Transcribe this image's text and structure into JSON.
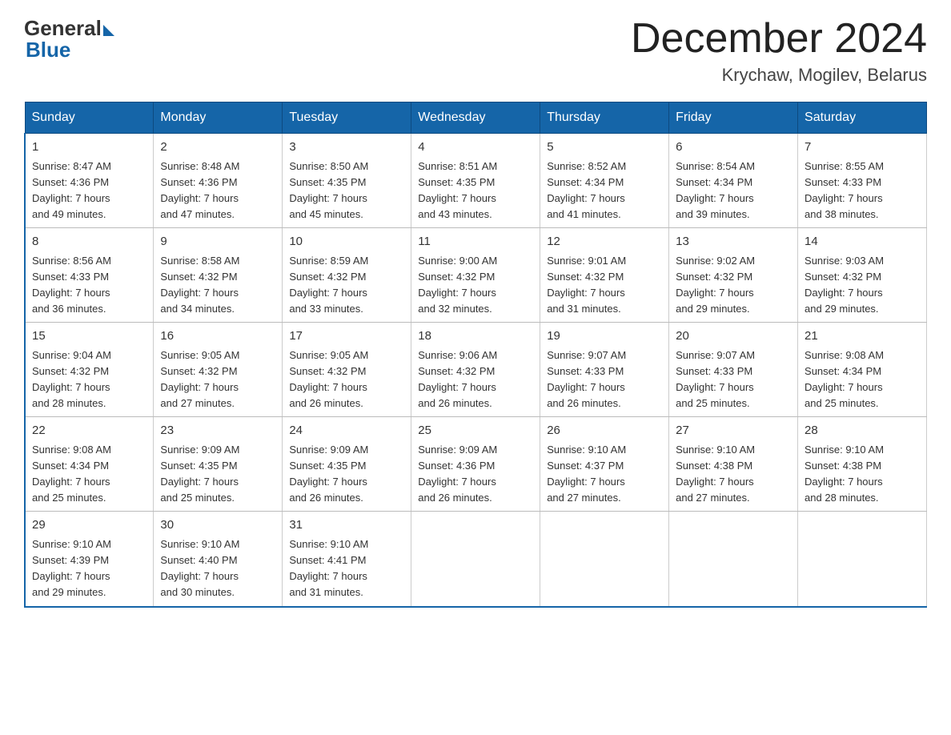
{
  "logo": {
    "text_general": "General",
    "text_blue": "Blue"
  },
  "header": {
    "month_title": "December 2024",
    "location": "Krychaw, Mogilev, Belarus"
  },
  "days_of_week": [
    "Sunday",
    "Monday",
    "Tuesday",
    "Wednesday",
    "Thursday",
    "Friday",
    "Saturday"
  ],
  "weeks": [
    [
      {
        "day": "1",
        "sunrise": "8:47 AM",
        "sunset": "4:36 PM",
        "daylight": "7 hours and 49 minutes."
      },
      {
        "day": "2",
        "sunrise": "8:48 AM",
        "sunset": "4:36 PM",
        "daylight": "7 hours and 47 minutes."
      },
      {
        "day": "3",
        "sunrise": "8:50 AM",
        "sunset": "4:35 PM",
        "daylight": "7 hours and 45 minutes."
      },
      {
        "day": "4",
        "sunrise": "8:51 AM",
        "sunset": "4:35 PM",
        "daylight": "7 hours and 43 minutes."
      },
      {
        "day": "5",
        "sunrise": "8:52 AM",
        "sunset": "4:34 PM",
        "daylight": "7 hours and 41 minutes."
      },
      {
        "day": "6",
        "sunrise": "8:54 AM",
        "sunset": "4:34 PM",
        "daylight": "7 hours and 39 minutes."
      },
      {
        "day": "7",
        "sunrise": "8:55 AM",
        "sunset": "4:33 PM",
        "daylight": "7 hours and 38 minutes."
      }
    ],
    [
      {
        "day": "8",
        "sunrise": "8:56 AM",
        "sunset": "4:33 PM",
        "daylight": "7 hours and 36 minutes."
      },
      {
        "day": "9",
        "sunrise": "8:58 AM",
        "sunset": "4:32 PM",
        "daylight": "7 hours and 34 minutes."
      },
      {
        "day": "10",
        "sunrise": "8:59 AM",
        "sunset": "4:32 PM",
        "daylight": "7 hours and 33 minutes."
      },
      {
        "day": "11",
        "sunrise": "9:00 AM",
        "sunset": "4:32 PM",
        "daylight": "7 hours and 32 minutes."
      },
      {
        "day": "12",
        "sunrise": "9:01 AM",
        "sunset": "4:32 PM",
        "daylight": "7 hours and 31 minutes."
      },
      {
        "day": "13",
        "sunrise": "9:02 AM",
        "sunset": "4:32 PM",
        "daylight": "7 hours and 29 minutes."
      },
      {
        "day": "14",
        "sunrise": "9:03 AM",
        "sunset": "4:32 PM",
        "daylight": "7 hours and 29 minutes."
      }
    ],
    [
      {
        "day": "15",
        "sunrise": "9:04 AM",
        "sunset": "4:32 PM",
        "daylight": "7 hours and 28 minutes."
      },
      {
        "day": "16",
        "sunrise": "9:05 AM",
        "sunset": "4:32 PM",
        "daylight": "7 hours and 27 minutes."
      },
      {
        "day": "17",
        "sunrise": "9:05 AM",
        "sunset": "4:32 PM",
        "daylight": "7 hours and 26 minutes."
      },
      {
        "day": "18",
        "sunrise": "9:06 AM",
        "sunset": "4:32 PM",
        "daylight": "7 hours and 26 minutes."
      },
      {
        "day": "19",
        "sunrise": "9:07 AM",
        "sunset": "4:33 PM",
        "daylight": "7 hours and 26 minutes."
      },
      {
        "day": "20",
        "sunrise": "9:07 AM",
        "sunset": "4:33 PM",
        "daylight": "7 hours and 25 minutes."
      },
      {
        "day": "21",
        "sunrise": "9:08 AM",
        "sunset": "4:34 PM",
        "daylight": "7 hours and 25 minutes."
      }
    ],
    [
      {
        "day": "22",
        "sunrise": "9:08 AM",
        "sunset": "4:34 PM",
        "daylight": "7 hours and 25 minutes."
      },
      {
        "day": "23",
        "sunrise": "9:09 AM",
        "sunset": "4:35 PM",
        "daylight": "7 hours and 25 minutes."
      },
      {
        "day": "24",
        "sunrise": "9:09 AM",
        "sunset": "4:35 PM",
        "daylight": "7 hours and 26 minutes."
      },
      {
        "day": "25",
        "sunrise": "9:09 AM",
        "sunset": "4:36 PM",
        "daylight": "7 hours and 26 minutes."
      },
      {
        "day": "26",
        "sunrise": "9:10 AM",
        "sunset": "4:37 PM",
        "daylight": "7 hours and 27 minutes."
      },
      {
        "day": "27",
        "sunrise": "9:10 AM",
        "sunset": "4:38 PM",
        "daylight": "7 hours and 27 minutes."
      },
      {
        "day": "28",
        "sunrise": "9:10 AM",
        "sunset": "4:38 PM",
        "daylight": "7 hours and 28 minutes."
      }
    ],
    [
      {
        "day": "29",
        "sunrise": "9:10 AM",
        "sunset": "4:39 PM",
        "daylight": "7 hours and 29 minutes."
      },
      {
        "day": "30",
        "sunrise": "9:10 AM",
        "sunset": "4:40 PM",
        "daylight": "7 hours and 30 minutes."
      },
      {
        "day": "31",
        "sunrise": "9:10 AM",
        "sunset": "4:41 PM",
        "daylight": "7 hours and 31 minutes."
      },
      null,
      null,
      null,
      null
    ]
  ],
  "labels": {
    "sunrise": "Sunrise:",
    "sunset": "Sunset:",
    "daylight": "Daylight:"
  }
}
